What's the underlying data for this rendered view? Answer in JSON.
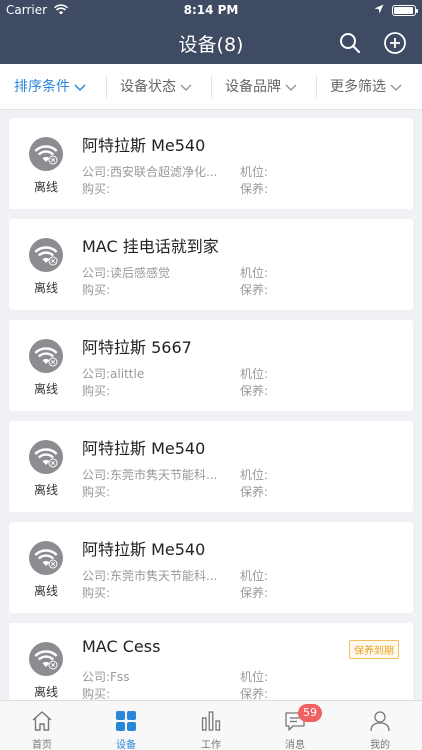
{
  "status_bar": {
    "carrier": "Carrier",
    "time": "8:14 PM"
  },
  "header": {
    "title": "设备(8)"
  },
  "filters": [
    {
      "label": "排序条件",
      "active": true
    },
    {
      "label": "设备状态",
      "active": false
    },
    {
      "label": "设备品牌",
      "active": false
    },
    {
      "label": "更多筛选",
      "active": false
    }
  ],
  "field_labels": {
    "company": "公司:",
    "position": "机位:",
    "purchase": "购买:",
    "maintenance": "保养:"
  },
  "devices": [
    {
      "name": "阿特拉斯 Me540",
      "status": "离线",
      "company": "西安联合超滤净化...",
      "badge": ""
    },
    {
      "name": "MAC 挂电话就到家",
      "status": "离线",
      "company": "读后感感觉",
      "badge": ""
    },
    {
      "name": "阿特拉斯 5667",
      "status": "离线",
      "company": "alittle",
      "badge": ""
    },
    {
      "name": "阿特拉斯 Me540",
      "status": "离线",
      "company": "东莞市隽天节能科...",
      "badge": ""
    },
    {
      "name": "阿特拉斯 Me540",
      "status": "离线",
      "company": "东莞市隽天节能科...",
      "badge": ""
    },
    {
      "name": "MAC Cess",
      "status": "离线",
      "company": "Fss",
      "badge": "保养到期"
    }
  ],
  "tabs": [
    {
      "label": "首页",
      "icon": "home-icon"
    },
    {
      "label": "设备",
      "icon": "grid-icon"
    },
    {
      "label": "工作",
      "icon": "bar-chart-icon"
    },
    {
      "label": "消息",
      "icon": "message-icon",
      "badge": "59"
    },
    {
      "label": "我的",
      "icon": "person-icon"
    }
  ],
  "active_tab": 1,
  "colors": {
    "header_bg": "#3f4a63",
    "accent": "#2a86d8",
    "badge": "#f06161",
    "warn": "#e9a21a"
  }
}
